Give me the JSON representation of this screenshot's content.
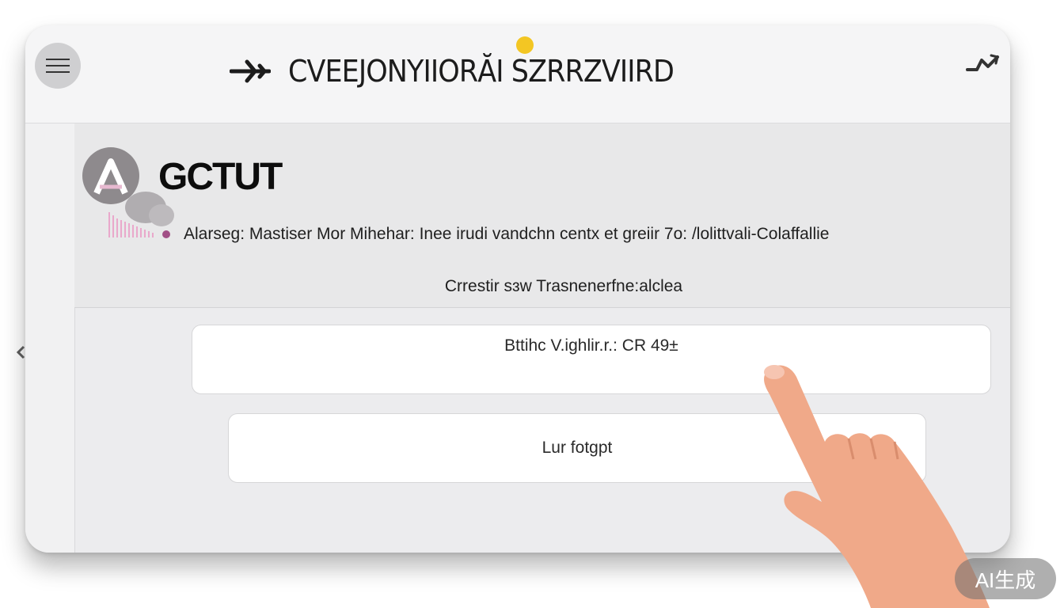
{
  "header": {
    "title": "CVEEJONYIIORĂI SZRRZVIIRD",
    "menu_icon": "hamburger-icon",
    "plane_icon": "plane-icon",
    "share_icon": "share-icon"
  },
  "profile": {
    "brand": "GCTUT",
    "description": "Alarseg: Mastiser Mor Mihehar: Inee irudi vandchn centx et greiir 7o: /lolittvali-Colaffallie",
    "subtitle": "Crrestir sɜw Trasnenerfne:alclea"
  },
  "cards": {
    "primary_label": "Bttihc V.ighlir.r.: CR 49±",
    "secondary_label": "Lur fotgpt"
  },
  "badge": {
    "label": "AI生成"
  },
  "colors": {
    "accent_sun": "#f3c623",
    "logo": "#8e8a8d",
    "hand": "#f0a989",
    "background": "#ececee"
  }
}
